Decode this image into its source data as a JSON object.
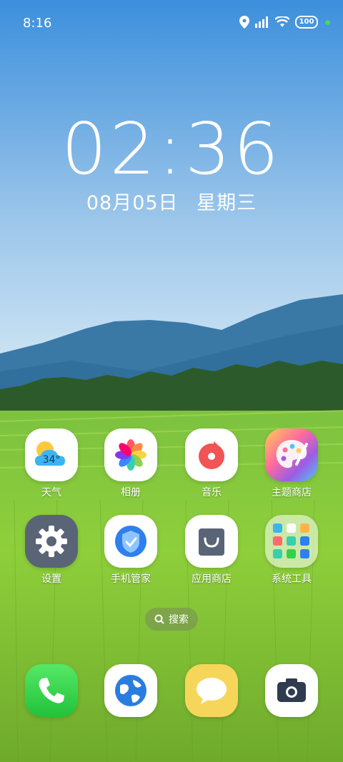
{
  "status": {
    "time": "8:16",
    "battery": "100"
  },
  "lock": {
    "time": "02:36",
    "date": "08月05日",
    "weekday": "星期三"
  },
  "apps": [
    {
      "label": "天气",
      "badge": "34°"
    },
    {
      "label": "相册"
    },
    {
      "label": "音乐"
    },
    {
      "label": "主题商店"
    },
    {
      "label": "设置"
    },
    {
      "label": "手机管家"
    },
    {
      "label": "应用商店"
    },
    {
      "label": "系统工具"
    }
  ],
  "search": {
    "label": "搜索"
  },
  "colors": {
    "phone": "#33d24c",
    "browser": "#2a7de0",
    "messages": "#f6d65a",
    "camera": "#2f3b4e"
  }
}
